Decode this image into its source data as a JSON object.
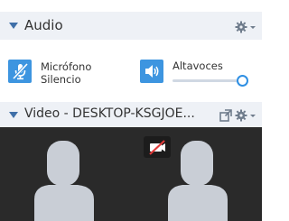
{
  "audio": {
    "title": "Audio",
    "microphone": {
      "label_line1": "Micrófono",
      "label_line2": "Silencio",
      "state": "muted"
    },
    "speaker": {
      "label": "Altavoces",
      "volume_fraction": 1.0
    }
  },
  "video": {
    "title": "Video - DESKTOP-KSGJOE..."
  },
  "icons": {
    "settings": "gear-icon",
    "dropdown": "chevron-down-icon",
    "microphone": "microphone-muted-icon",
    "speaker": "speaker-icon",
    "popout": "popout-icon",
    "camera": "camera-off-icon"
  },
  "colors": {
    "accent": "#3d95e0",
    "header_bg": "#eef1f6",
    "caret": "#3f6fa8",
    "video_bg": "#2a2a2a",
    "silhouette": "#c9ced6",
    "camera_off": "#e03a3a"
  }
}
